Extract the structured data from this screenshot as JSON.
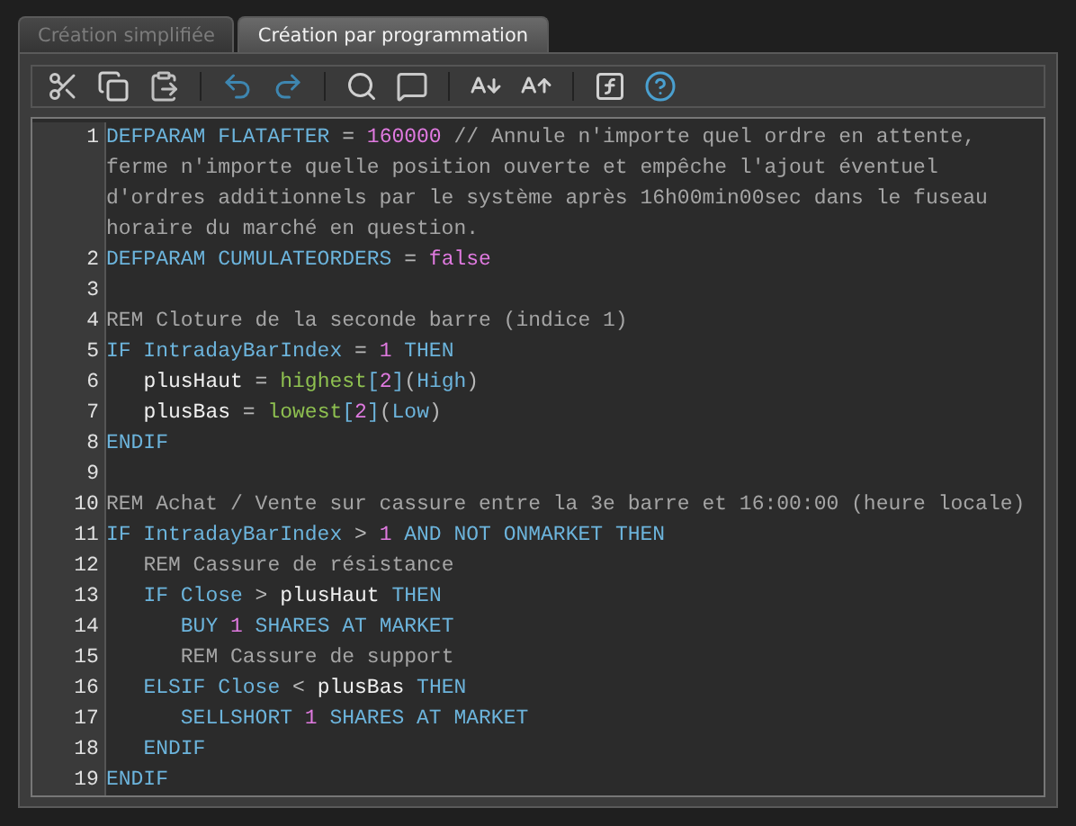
{
  "tabs": [
    {
      "label": "Création simplifiée",
      "selected": false
    },
    {
      "label": "Création par programmation",
      "selected": true
    }
  ],
  "toolbar": [
    {
      "kind": "cut"
    },
    {
      "kind": "copy"
    },
    {
      "kind": "paste"
    },
    {
      "kind": "sep"
    },
    {
      "kind": "undo"
    },
    {
      "kind": "redo"
    },
    {
      "kind": "sep"
    },
    {
      "kind": "search"
    },
    {
      "kind": "comment"
    },
    {
      "kind": "sep"
    },
    {
      "kind": "font-smaller"
    },
    {
      "kind": "font-larger"
    },
    {
      "kind": "sep"
    },
    {
      "kind": "function"
    },
    {
      "kind": "help"
    }
  ],
  "editor": {
    "lines": [
      {
        "number": "1",
        "tokens": [
          {
            "kind": "kw",
            "text": "DEFPARAM FLATAFTER"
          },
          {
            "kind": "op",
            "text": " = "
          },
          {
            "kind": "num",
            "text": "160000"
          },
          {
            "kind": "cmt",
            "text": " // Annule n'importe quel ordre en attente, ferme n'importe quelle position ouverte et empêche l'ajout éventuel d'ordres additionnels par le système après 16h00min00sec dans le fuseau horaire du marché en question."
          }
        ]
      },
      {
        "number": "2",
        "tokens": [
          {
            "kind": "kw",
            "text": "DEFPARAM CUMULATEORDERS"
          },
          {
            "kind": "op",
            "text": " = "
          },
          {
            "kind": "num",
            "text": "false"
          }
        ]
      },
      {
        "number": "3"
      },
      {
        "number": "4",
        "tokens": [
          {
            "kind": "cmt",
            "text": "REM Cloture de la seconde barre (indice 1)"
          }
        ]
      },
      {
        "number": "5",
        "tokens": [
          {
            "kind": "kw",
            "text": "IF IntradayBarIndex"
          },
          {
            "kind": "op",
            "text": " = "
          },
          {
            "kind": "num",
            "text": "1"
          },
          {
            "kind": "kw",
            "text": " THEN"
          }
        ]
      },
      {
        "number": "6",
        "tokens": [
          {
            "kind": "id",
            "text": "   plusHaut"
          },
          {
            "kind": "op",
            "text": " = "
          },
          {
            "kind": "fn",
            "text": "highest"
          },
          {
            "kind": "kw",
            "text": "["
          },
          {
            "kind": "num",
            "text": "2"
          },
          {
            "kind": "kw",
            "text": "]"
          },
          {
            "kind": "op",
            "text": "("
          },
          {
            "kind": "kw",
            "text": "High"
          },
          {
            "kind": "op",
            "text": ")"
          }
        ]
      },
      {
        "number": "7",
        "tokens": [
          {
            "kind": "id",
            "text": "   plusBas"
          },
          {
            "kind": "op",
            "text": " = "
          },
          {
            "kind": "fn",
            "text": "lowest"
          },
          {
            "kind": "kw",
            "text": "["
          },
          {
            "kind": "num",
            "text": "2"
          },
          {
            "kind": "kw",
            "text": "]"
          },
          {
            "kind": "op",
            "text": "("
          },
          {
            "kind": "kw",
            "text": "Low"
          },
          {
            "kind": "op",
            "text": ")"
          }
        ]
      },
      {
        "number": "8",
        "tokens": [
          {
            "kind": "kw",
            "text": "ENDIF"
          }
        ]
      },
      {
        "number": "9"
      },
      {
        "number": "10",
        "tokens": [
          {
            "kind": "cmt",
            "text": "REM Achat / Vente sur cassure entre la 3e barre et 16:00:00 (heure locale)"
          }
        ]
      },
      {
        "number": "11",
        "tokens": [
          {
            "kind": "kw",
            "text": "IF IntradayBarIndex"
          },
          {
            "kind": "op",
            "text": " > "
          },
          {
            "kind": "num",
            "text": "1"
          },
          {
            "kind": "kw",
            "text": " AND NOT ONMARKET THEN"
          }
        ]
      },
      {
        "number": "12",
        "tokens": [
          {
            "kind": "cmt",
            "text": "   REM Cassure de résistance"
          }
        ]
      },
      {
        "number": "13",
        "tokens": [
          {
            "kind": "kw",
            "text": "   IF Close"
          },
          {
            "kind": "op",
            "text": " > "
          },
          {
            "kind": "id",
            "text": "plusHaut"
          },
          {
            "kind": "kw",
            "text": " THEN"
          }
        ]
      },
      {
        "number": "14",
        "tokens": [
          {
            "kind": "kw",
            "text": "      BUY "
          },
          {
            "kind": "num",
            "text": "1"
          },
          {
            "kind": "kw",
            "text": " SHARES AT MARKET"
          }
        ]
      },
      {
        "number": "15",
        "tokens": [
          {
            "kind": "cmt",
            "text": "      REM Cassure de support"
          }
        ]
      },
      {
        "number": "16",
        "tokens": [
          {
            "kind": "kw",
            "text": "   ELSIF Close"
          },
          {
            "kind": "op",
            "text": " < "
          },
          {
            "kind": "id",
            "text": "plusBas"
          },
          {
            "kind": "kw",
            "text": " THEN"
          }
        ]
      },
      {
        "number": "17",
        "tokens": [
          {
            "kind": "kw",
            "text": "      SELLSHORT "
          },
          {
            "kind": "num",
            "text": "1"
          },
          {
            "kind": "kw",
            "text": " SHARES AT MARKET"
          }
        ]
      },
      {
        "number": "18",
        "tokens": [
          {
            "kind": "kw",
            "text": "   ENDIF"
          }
        ]
      },
      {
        "number": "19",
        "tokens": [
          {
            "kind": "kw",
            "text": "ENDIF"
          }
        ]
      }
    ]
  }
}
